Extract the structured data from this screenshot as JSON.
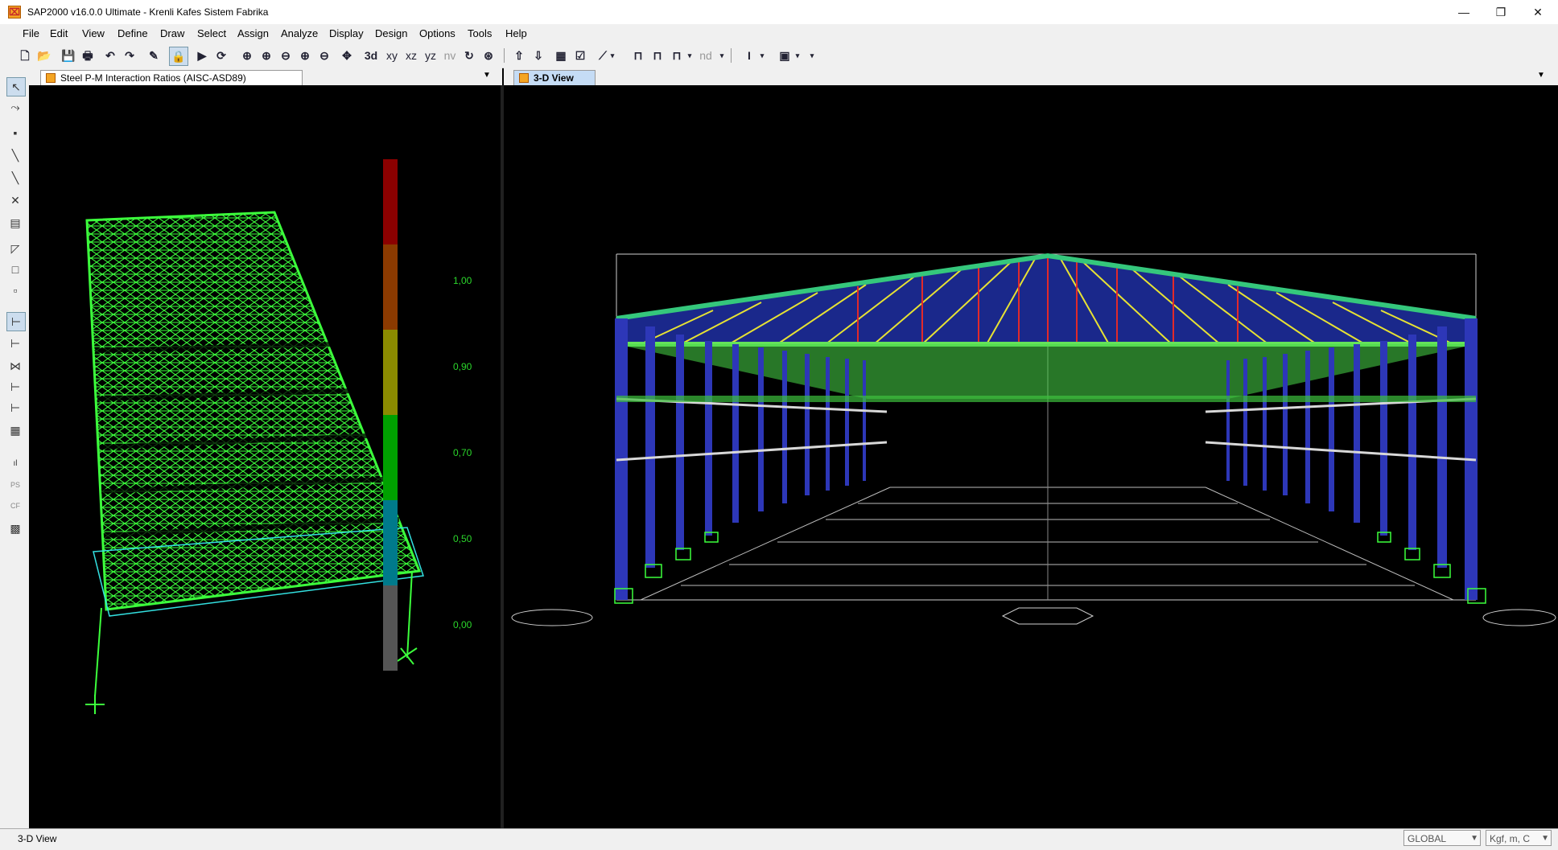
{
  "window": {
    "title": "SAP2000 v16.0.0 Ultimate  - Krenli Kafes Sistem Fabrika",
    "icon": "sap2000-app-icon",
    "minimize_label": "—",
    "restore_label": "❐",
    "close_label": "✕"
  },
  "menu": [
    "File",
    "Edit",
    "View",
    "Define",
    "Draw",
    "Select",
    "Assign",
    "Analyze",
    "Display",
    "Design",
    "Options",
    "Tools",
    "Help"
  ],
  "toolbar": {
    "view_buttons": [
      "xy",
      "xz",
      "yz",
      "nv"
    ],
    "nd_label": "nd"
  },
  "left_panel": {
    "tab_title": "Steel P-M Interaction Ratios  (AISC-ASD89)",
    "legend": {
      "labels": [
        "1,00",
        "0,90",
        "0,70",
        "0,50",
        "0,00"
      ],
      "colors": [
        "#8b0000",
        "#8b3a00",
        "#8b8b00",
        "#00a000",
        "#007a8b",
        "#555555"
      ]
    }
  },
  "right_panel": {
    "tab_title": "3-D View"
  },
  "status": {
    "text": "3-D View",
    "coord_system": "GLOBAL",
    "units": "Kgf, m, C"
  }
}
